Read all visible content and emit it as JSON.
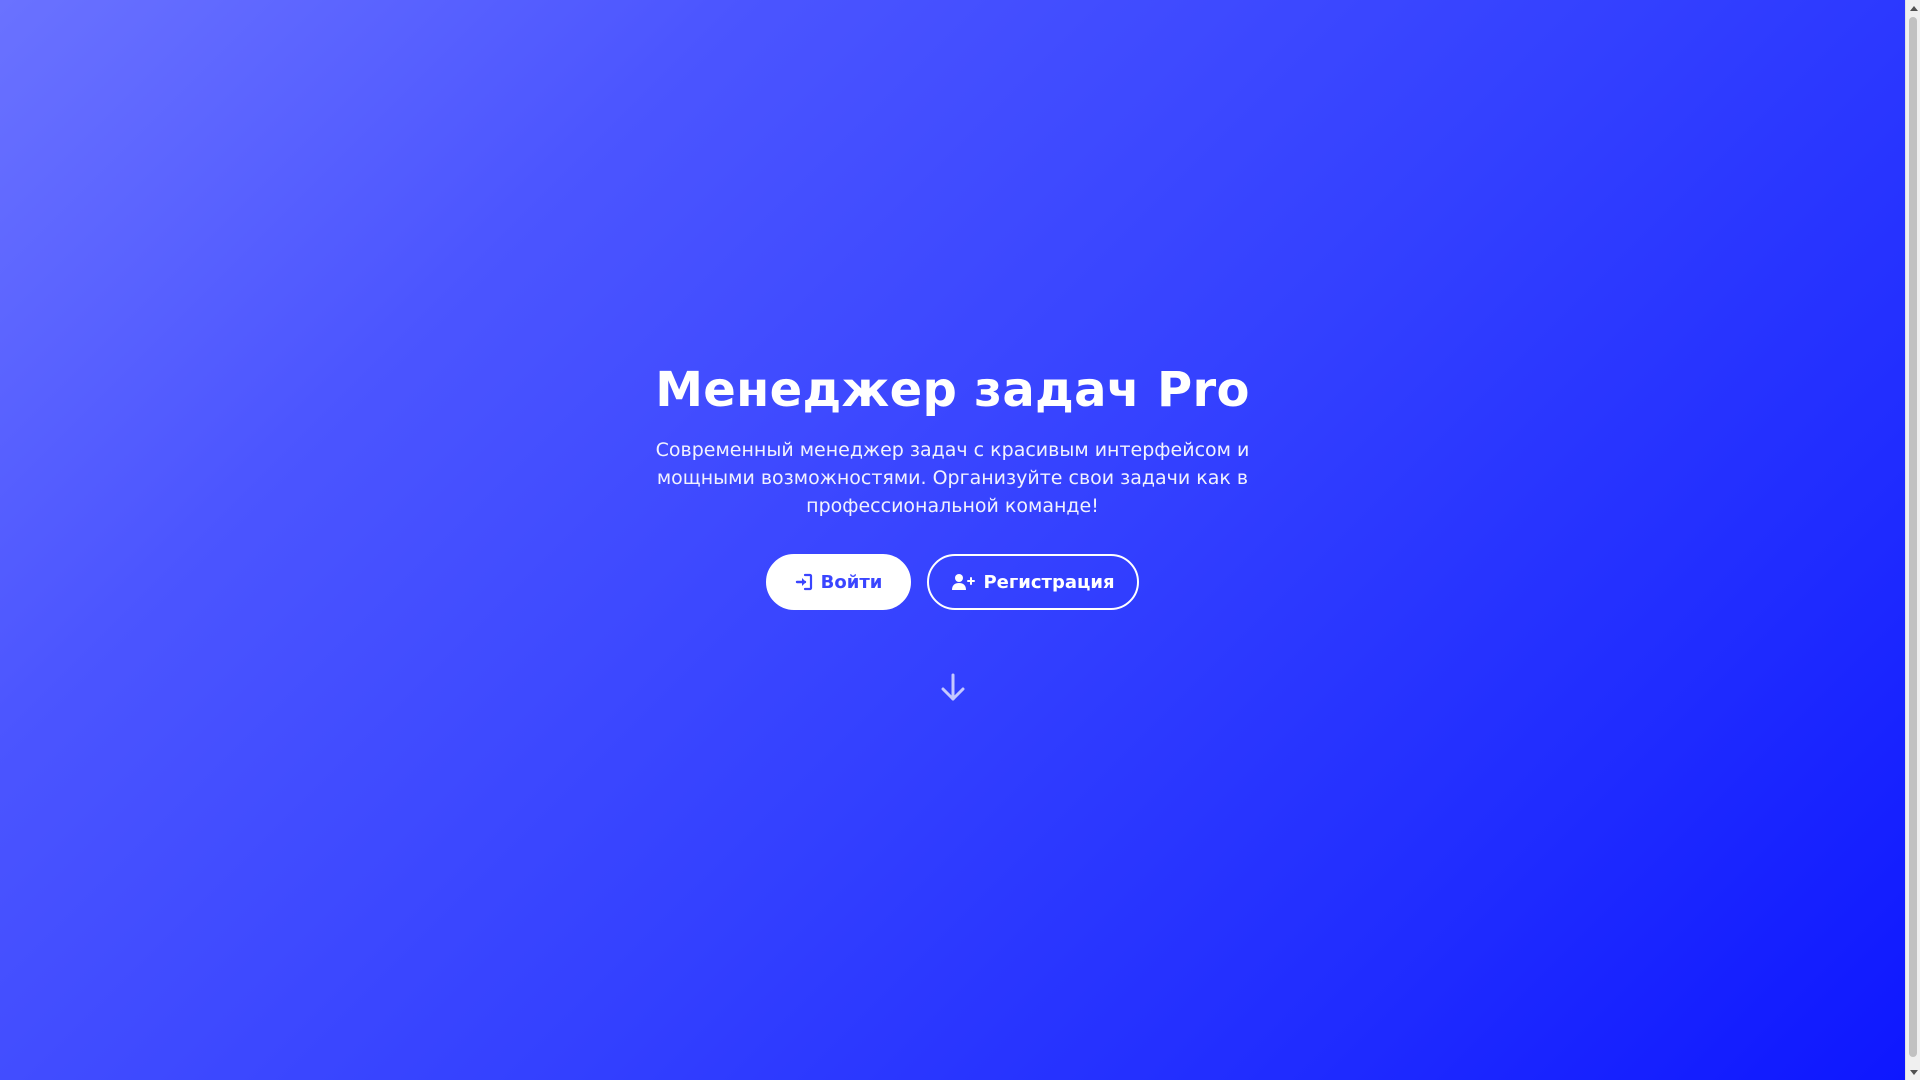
{
  "hero": {
    "title": "Менеджер задач Pro",
    "subtitle": "Современный менеджер задач с красивым интерфейсом и мощными возможностями. Организуйте свои задачи как в профессиональной команде!",
    "login_label": "Войти",
    "register_label": "Регистрация",
    "login_icon": "sign-in-icon",
    "register_icon": "user-plus-icon",
    "scroll_icon": "arrow-down-icon"
  },
  "colors": {
    "gradient_start": "#6a72ff",
    "gradient_end": "#0e17ff",
    "accent": "#3a45ff",
    "text": "#ffffff"
  }
}
